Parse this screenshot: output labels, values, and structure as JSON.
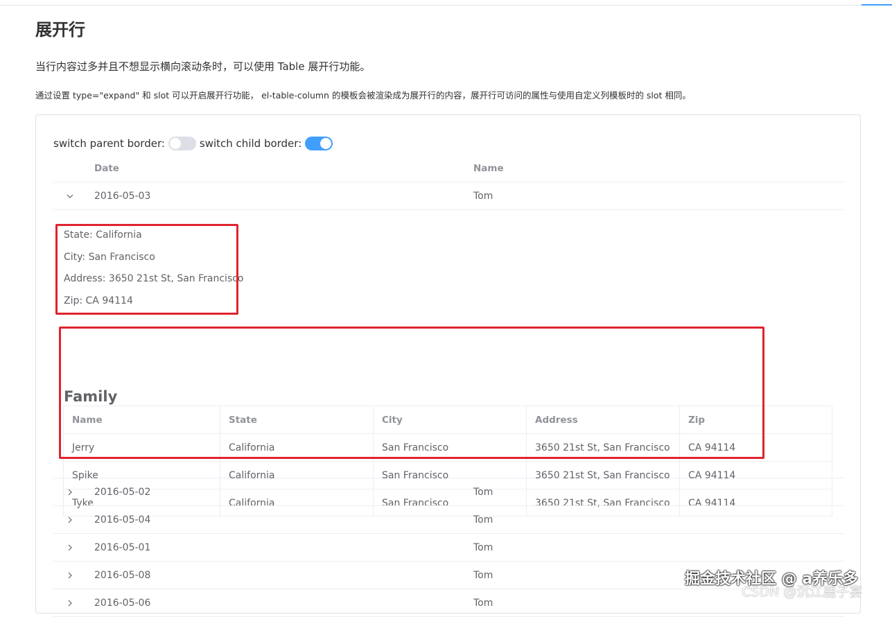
{
  "page": {
    "title": "展开行",
    "lead": "当行内容过多并且不想显示横向滚动条时，可以使用 Table 展开行功能。",
    "description": "通过设置 type=\"expand\" 和 slot 可以开启展开行功能， el-table-column 的模板会被渲染成为展开行的内容，展开行可访问的属性与使用自定义列模板时的 slot 相同。"
  },
  "switches": {
    "parent_label": "switch parent border:",
    "parent_state": "off",
    "child_label": "switch child border:",
    "child_state": "on"
  },
  "table": {
    "headers": {
      "date": "Date",
      "name": "Name"
    },
    "expanded_row": {
      "date": "2016-05-03",
      "name": "Tom",
      "state": "State: California",
      "city": "City: San Francisco",
      "address": "Address: 3650 21st St, San Francisco",
      "zip": "Zip: CA 94114",
      "family_title": "Family",
      "family_headers": [
        "Name",
        "State",
        "City",
        "Address",
        "Zip"
      ],
      "family_rows": [
        [
          "Jerry",
          "California",
          "San Francisco",
          "3650 21st St, San Francisco",
          "CA 94114"
        ],
        [
          "Spike",
          "California",
          "San Francisco",
          "3650 21st St, San Francisco",
          "CA 94114"
        ],
        [
          "Tyke",
          "California",
          "San Francisco",
          "3650 21st St, San Francisco",
          "CA 94114"
        ]
      ]
    },
    "collapsed_rows": [
      {
        "date": "2016-05-02",
        "name": "Tom"
      },
      {
        "date": "2016-05-04",
        "name": "Tom"
      },
      {
        "date": "2016-05-01",
        "name": "Tom"
      },
      {
        "date": "2016-05-08",
        "name": "Tom"
      },
      {
        "date": "2016-05-06",
        "name": "Tom"
      }
    ]
  },
  "watermark": {
    "main": "掘金技术社区 @ a养乐多",
    "sub": "CSDN @沉江鹿子宴"
  },
  "colors": {
    "accent": "#409eff",
    "highlight": "#e0232d"
  },
  "icons": {
    "expanded": "chevron-down-icon",
    "collapsed": "chevron-right-icon"
  }
}
